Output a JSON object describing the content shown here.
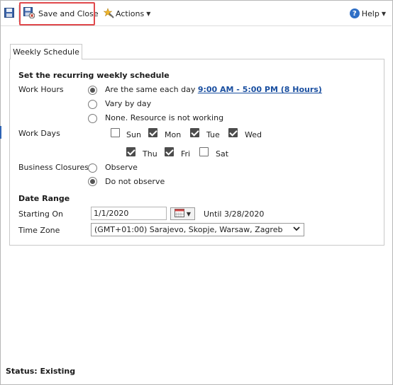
{
  "toolbar": {
    "save_close_label": "Save and Close",
    "actions_label": "Actions",
    "help_label": "Help"
  },
  "tabs": [
    {
      "label": "Weekly Schedule"
    }
  ],
  "schedule": {
    "heading": "Set the recurring weekly schedule",
    "work_hours": {
      "label": "Work Hours",
      "options": [
        {
          "text": "Are the same each day",
          "selected": true,
          "link": "9:00 AM - 5:00 PM (8 Hours)"
        },
        {
          "text": "Vary by day",
          "selected": false
        },
        {
          "text": "None. Resource is not working",
          "selected": false
        }
      ]
    },
    "work_days": {
      "label": "Work Days",
      "days": [
        {
          "name": "Sun",
          "checked": false
        },
        {
          "name": "Mon",
          "checked": true
        },
        {
          "name": "Tue",
          "checked": true
        },
        {
          "name": "Wed",
          "checked": true
        },
        {
          "name": "Thu",
          "checked": true
        },
        {
          "name": "Fri",
          "checked": true
        },
        {
          "name": "Sat",
          "checked": false
        }
      ]
    },
    "business_closures": {
      "label": "Business Closures",
      "options": [
        {
          "text": "Observe",
          "selected": false
        },
        {
          "text": "Do not observe",
          "selected": true
        }
      ]
    }
  },
  "date_range": {
    "heading": "Date Range",
    "starting_on_label": "Starting On",
    "starting_on_value": "1/1/2020",
    "until_text": "Until 3/28/2020",
    "time_zone_label": "Time Zone",
    "time_zone_value": "(GMT+01:00) Sarajevo, Skopje, Warsaw, Zagreb"
  },
  "status": {
    "text": "Status: Existing"
  },
  "colors": {
    "highlight": "#e0484b",
    "link": "#1a4fa0",
    "accent": "#2f6fc6"
  }
}
